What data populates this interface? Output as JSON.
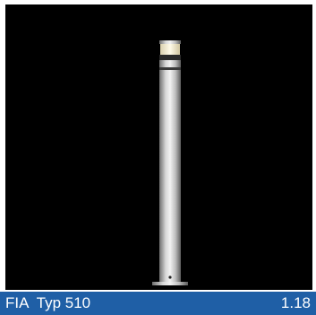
{
  "caption": {
    "product": "FIA  Typ 510",
    "code": "1.18"
  },
  "colors": {
    "frame_background": "#ffffff",
    "viewport_background": "#000000",
    "caption_bar": "#1f5fa6",
    "caption_text": "#ffffff",
    "lamp_glow": "#fff6d8",
    "pole_metal": "#c8c8c8"
  },
  "illustration": {
    "subject": "bollard-light-pole",
    "icon": "bollard-light-icon"
  }
}
